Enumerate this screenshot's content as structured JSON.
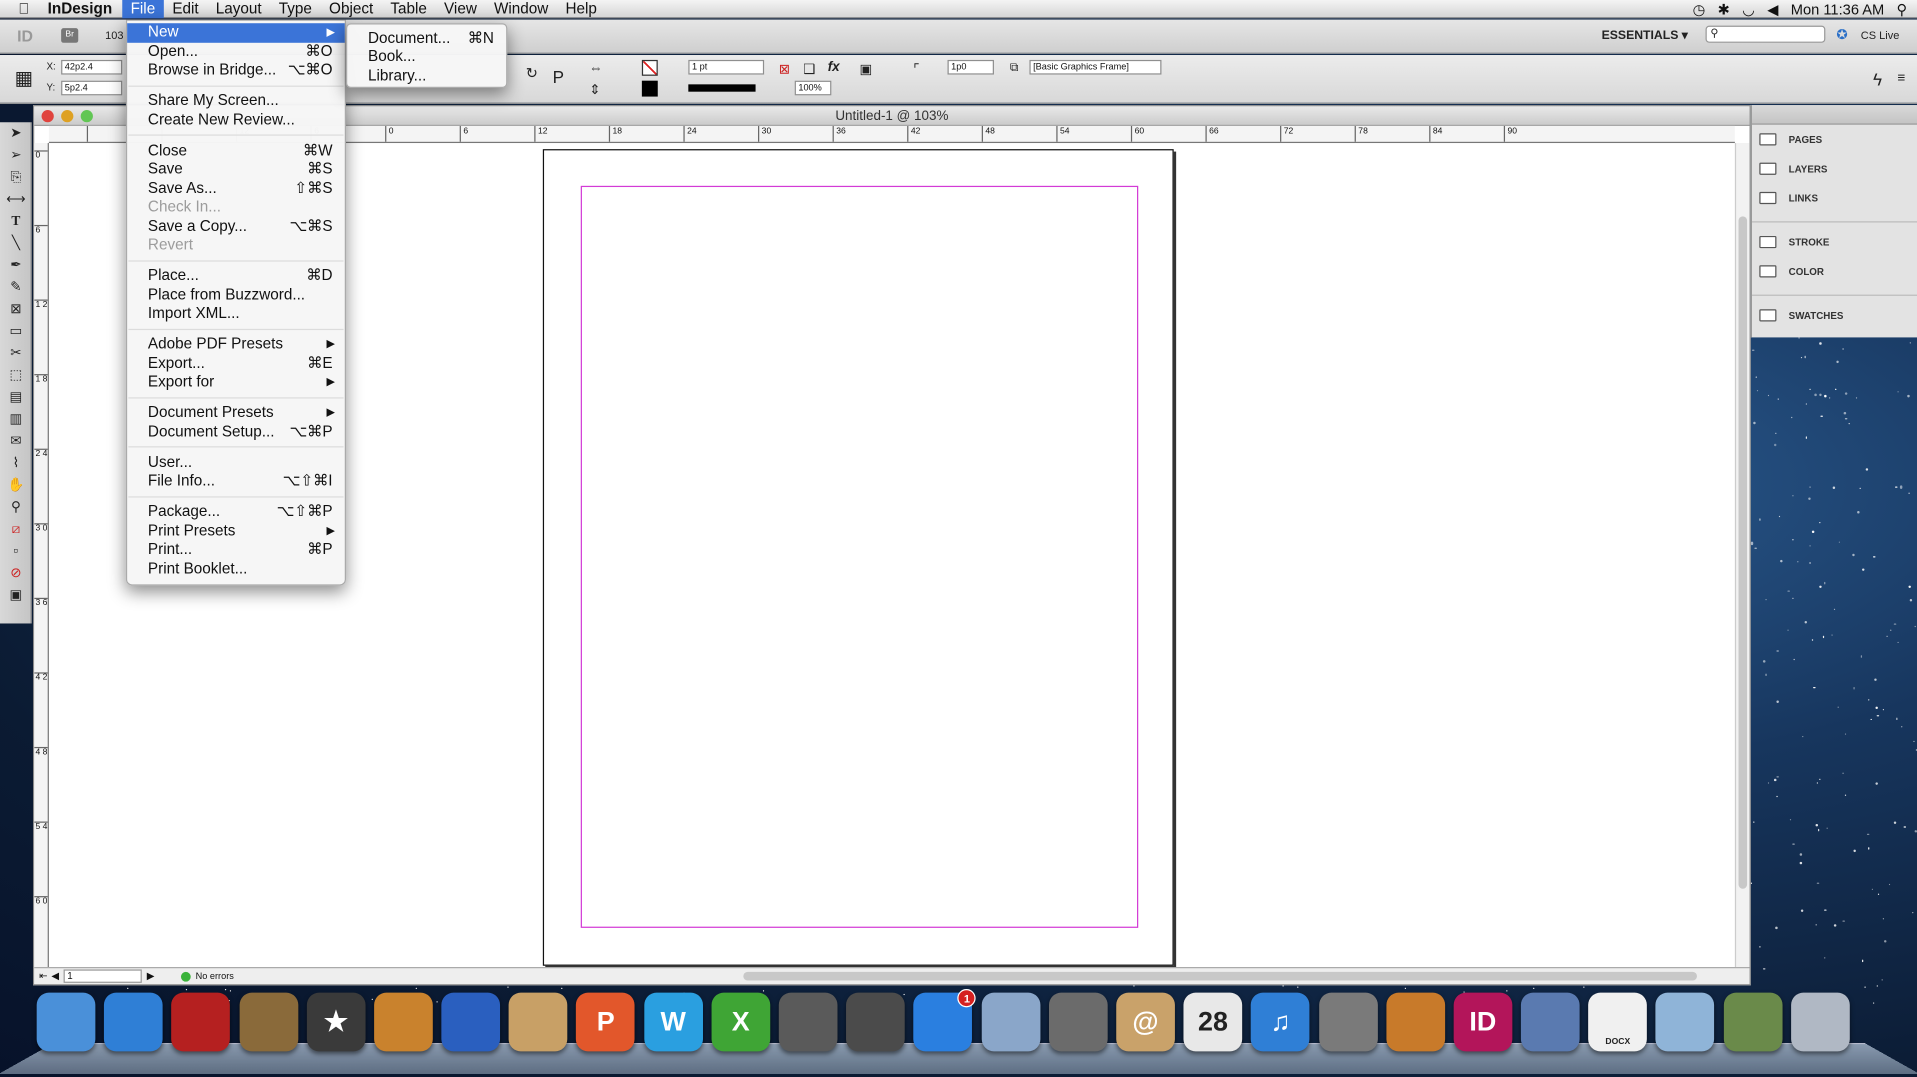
{
  "menubar": {
    "apple": "",
    "app_name": "InDesign",
    "items": [
      "File",
      "Edit",
      "Layout",
      "Type",
      "Object",
      "Table",
      "View",
      "Window",
      "Help"
    ],
    "clock": "Mon 11:36 AM"
  },
  "appbar": {
    "id_logo": "ID",
    "bridge": "Br",
    "zoom": "103",
    "workspace": "ESSENTIALS ▾",
    "search_placeholder": "",
    "cslive": "CS Live"
  },
  "control": {
    "x_label": "X:",
    "x_value": "42p2.4",
    "y_label": "Y:",
    "y_value": "5p2.4",
    "stroke_weight": "1 pt",
    "opacity": "100%",
    "offset": "1p0",
    "object_style": "[Basic Graphics Frame]"
  },
  "document": {
    "title": "Untitled-1 @ 103%",
    "page_number": "1",
    "status": "No errors",
    "hruler_ticks": [
      "36",
      "",
      "",
      "12",
      "6",
      "0",
      "6",
      "12",
      "18",
      "24",
      "30",
      "36",
      "42",
      "48",
      "54",
      "60",
      "66",
      "72",
      "78",
      "84",
      "90"
    ],
    "vruler_ticks": [
      "0",
      "6",
      "1 2",
      "1 8",
      "2 4",
      "3 0",
      "3 6",
      "4 2",
      "4 8",
      "5 4",
      "6 0"
    ]
  },
  "file_menu": {
    "items": [
      {
        "label": "New",
        "shortcut": "",
        "submenu": true,
        "state": "selected"
      },
      {
        "label": "Open...",
        "shortcut": "⌘O"
      },
      {
        "label": "Browse in Bridge...",
        "shortcut": "⌥⌘O"
      },
      {
        "sep": true
      },
      {
        "label": "Share My Screen...",
        "shortcut": ""
      },
      {
        "label": "Create New Review...",
        "shortcut": ""
      },
      {
        "sep": true
      },
      {
        "label": "Close",
        "shortcut": "⌘W"
      },
      {
        "label": "Save",
        "shortcut": "⌘S"
      },
      {
        "label": "Save As...",
        "shortcut": "⇧⌘S"
      },
      {
        "label": "Check In...",
        "shortcut": "",
        "state": "disabled"
      },
      {
        "label": "Save a Copy...",
        "shortcut": "⌥⌘S"
      },
      {
        "label": "Revert",
        "shortcut": "",
        "state": "disabled"
      },
      {
        "sep": true
      },
      {
        "label": "Place...",
        "shortcut": "⌘D"
      },
      {
        "label": "Place from Buzzword...",
        "shortcut": ""
      },
      {
        "label": "Import XML...",
        "shortcut": ""
      },
      {
        "sep": true
      },
      {
        "label": "Adobe PDF Presets",
        "shortcut": "",
        "submenu": true
      },
      {
        "label": "Export...",
        "shortcut": "⌘E"
      },
      {
        "label": "Export for",
        "shortcut": "",
        "submenu": true
      },
      {
        "sep": true
      },
      {
        "label": "Document Presets",
        "shortcut": "",
        "submenu": true
      },
      {
        "label": "Document Setup...",
        "shortcut": "⌥⌘P"
      },
      {
        "sep": true
      },
      {
        "label": "User...",
        "shortcut": ""
      },
      {
        "label": "File Info...",
        "shortcut": "⌥⇧⌘I"
      },
      {
        "sep": true
      },
      {
        "label": "Package...",
        "shortcut": "⌥⇧⌘P"
      },
      {
        "label": "Print Presets",
        "shortcut": "",
        "submenu": true
      },
      {
        "label": "Print...",
        "shortcut": "⌘P"
      },
      {
        "label": "Print Booklet...",
        "shortcut": ""
      }
    ]
  },
  "new_submenu": {
    "items": [
      {
        "label": "Document...",
        "shortcut": "⌘N"
      },
      {
        "label": "Book...",
        "shortcut": ""
      },
      {
        "label": "Library...",
        "shortcut": ""
      }
    ]
  },
  "panels": {
    "group1": [
      "PAGES",
      "LAYERS",
      "LINKS"
    ],
    "group2": [
      "STROKE",
      "COLOR"
    ],
    "group3": [
      "SWATCHES"
    ]
  },
  "dock": {
    "items": [
      {
        "name": "finder",
        "label": "",
        "color": "#4a90d9"
      },
      {
        "name": "safari",
        "label": "",
        "color": "#2f7fd6"
      },
      {
        "name": "photo-booth",
        "label": "",
        "color": "#b52020"
      },
      {
        "name": "iphoto",
        "label": "",
        "color": "#8a6a3a"
      },
      {
        "name": "imovie",
        "label": "★",
        "color": "#3a3a3a"
      },
      {
        "name": "garageband",
        "label": "",
        "color": "#c9822d"
      },
      {
        "name": "dvd-player",
        "label": "",
        "color": "#2a5fbf"
      },
      {
        "name": "preview",
        "label": "",
        "color": "#c8a066"
      },
      {
        "name": "powerpoint",
        "label": "P",
        "color": "#e2572b"
      },
      {
        "name": "word",
        "label": "W",
        "color": "#2a9fe0"
      },
      {
        "name": "excel",
        "label": "X",
        "color": "#3fa535"
      },
      {
        "name": "launchpad",
        "label": "",
        "color": "#5a5a5a"
      },
      {
        "name": "image-capture",
        "label": "",
        "color": "#4b4b4b"
      },
      {
        "name": "app-store",
        "label": "",
        "color": "#2a7fe0",
        "badge": "1"
      },
      {
        "name": "migration",
        "label": "",
        "color": "#8aa6c9"
      },
      {
        "name": "facetime",
        "label": "",
        "color": "#6b6b6b"
      },
      {
        "name": "address-book",
        "label": "@",
        "color": "#c9a26a"
      },
      {
        "name": "ical",
        "label": "28",
        "color": "#e8e8e8"
      },
      {
        "name": "itunes",
        "label": "♫",
        "color": "#2f7fd6"
      },
      {
        "name": "system-preferences",
        "label": "",
        "color": "#7a7a7a"
      },
      {
        "name": "presentation",
        "label": "",
        "color": "#c87a2a"
      },
      {
        "name": "indesign",
        "label": "ID",
        "color": "#b3155a"
      },
      {
        "name": "iphoto-2",
        "label": "",
        "color": "#5a7ab0"
      },
      {
        "name": "docx",
        "label": "DOCX",
        "color": "#f0f0f0"
      },
      {
        "name": "folder",
        "label": "",
        "color": "#8fb4d8"
      },
      {
        "name": "image-stack",
        "label": "",
        "color": "#6a8a4a"
      },
      {
        "name": "trash",
        "label": "",
        "color": "#b0b8c4"
      }
    ]
  },
  "colors": {
    "selection": "#3b74d8",
    "margin_guide": "#d33bd6"
  }
}
